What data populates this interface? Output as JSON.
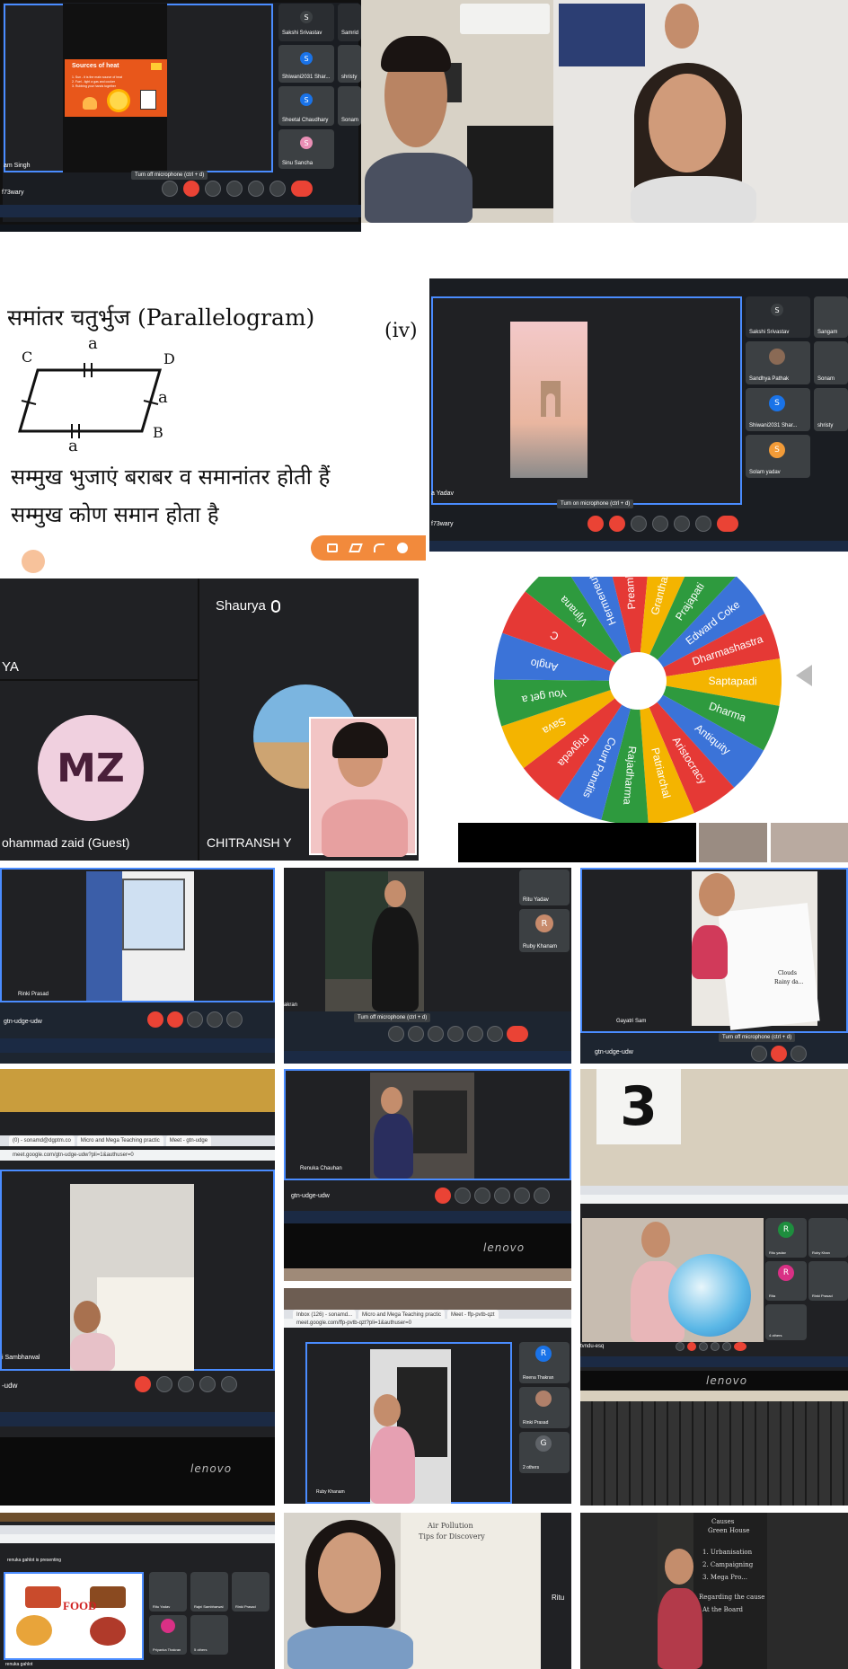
{
  "collage": {
    "c1": {
      "slide_title": "Sources of heat",
      "slide_lines": [
        "1. Sun - it is the main source of heat",
        "2. Fuel - light a gas and cooker",
        "3. Rubbing your hands together"
      ],
      "participants": [
        "Sakshi Srivastav",
        "Samrid",
        "Shiwani2031 Shar...",
        "shristy",
        "Sheetal Chaudhary",
        "Sonam",
        "Sinu Sancha"
      ],
      "avatar_letter": "S",
      "left_name": "am Singh",
      "bottom_code": "f73wary",
      "tooltip": "Turn off microphone (ctrl + d)"
    },
    "c3": {
      "line1": "समांतर चतुर्भुज (Parallelogram)",
      "roman": "(iv)",
      "labels": {
        "a_top": "a",
        "a_right": "a",
        "a_bottom": "a",
        "c": "C",
        "d": "D",
        "b": "B"
      },
      "line2": "सम्मुख भुजाएं बराबर व समानांतर होती हैं",
      "line3": "सम्मुख कोण समान होता है"
    },
    "c4": {
      "participants": [
        "Sakshi Srivastav",
        "Sangam",
        "Sandhya Pathak",
        "Sonam",
        "Shiwani2031 Shar...",
        "shristy",
        "Solam yadav"
      ],
      "avatar_letter": "S",
      "left_name": "a Yadav",
      "bottom_code": "f73wary",
      "tooltip": "Turn on microphone (ctrl + d)"
    },
    "c5": {
      "name_top": "Shaurya",
      "name_left_top": "YA",
      "initials": "MZ",
      "name_bottom_left": "ohammad zaid (Guest)",
      "name_bottom_right": "CHITRANSH Y"
    },
    "c6": {
      "wheel_labels": [
        "Vijnana",
        "Hermeneutics",
        "Preamble",
        "Granthasta",
        "Prajapati",
        "Edward Coke",
        "Dharmashastra",
        "Saptapadi",
        "Dharma",
        "Antiquity",
        "Aristocracy",
        "Patriarchal",
        "Rajadharma",
        "Court Pandits",
        "Rigveda",
        "Sava",
        "You get a",
        "Anglo",
        "C"
      ],
      "wheel_colors": [
        "#2e9a3e",
        "#3b73d8",
        "#e53935",
        "#f4b400"
      ]
    },
    "c7": {
      "name": "Rinki Prasad",
      "code": "gtn-udge-udw"
    },
    "c8": {
      "name": "akran",
      "code": "gtn-udge-udw",
      "side": [
        "Ritu Yadav",
        "Ruby Khanam"
      ],
      "avatar_letter": "R",
      "tooltip": "Turn off microphone (ctrl + d)"
    },
    "c9": {
      "name": "Gayatri Sam",
      "code": "gtn-udge-udw",
      "tooltip": "Turn off microphone (ctrl + d)",
      "board_text": [
        "Clouds",
        "Rainy da..."
      ]
    },
    "c10": {
      "tabs": [
        "(0) - sonamd@dgptm.co",
        "Micro and Mega Teaching practic",
        "Meet - gtn-udge"
      ],
      "url": "meet.google.com/gtn-udge-udw?pli=1&authuser=0",
      "name": "i Sambharwal",
      "code": "-udw",
      "brand": "lenovo"
    },
    "c11": {
      "name": "Renuka Chauhan",
      "code": "gtn-udge-udw",
      "brand": "lenovo"
    },
    "c12": {
      "number": "3",
      "side": [
        "Ritu yadav",
        "Ruby Khan",
        "Rita",
        "Rinki Prasad",
        "4 others"
      ],
      "side_letters": [
        "R",
        "R"
      ],
      "code": "tvndu-esq",
      "brand": "lenovo"
    },
    "c13": {
      "tabs": [
        "Inbox (126) - sonamd...",
        "Micro and Mega Teaching practic",
        "Meet - ffp-pvtb-qzt"
      ],
      "url": "meet.google.com/ffp-pvtb-qzt?pli=1&authuser=0",
      "side": [
        "Reena Thakran",
        "Rinki Prasad",
        "2 others"
      ],
      "side_letters": [
        "R",
        "G"
      ],
      "name": "Ruby Khanam"
    },
    "c14": {
      "presenting": "renuka gahlot is presenting",
      "slide_word": "FOOD",
      "side": [
        "Ritu Yadav",
        "Rajni Sambharwal",
        "Rinki Prasad",
        "Priyanka Thakran",
        "5 others"
      ],
      "bottom": "renuka gahlot"
    },
    "c15": {
      "board_lines": [
        "Air Pollution",
        "Tips for Discovery"
      ],
      "side": "Ritu"
    },
    "c16": {
      "board_lines": [
        "Causes",
        "Green House",
        "1. Urbanisation",
        "2. Campaigning",
        "3. Mega Pro...",
        "Regarding the cause",
        "At the Board"
      ]
    }
  }
}
